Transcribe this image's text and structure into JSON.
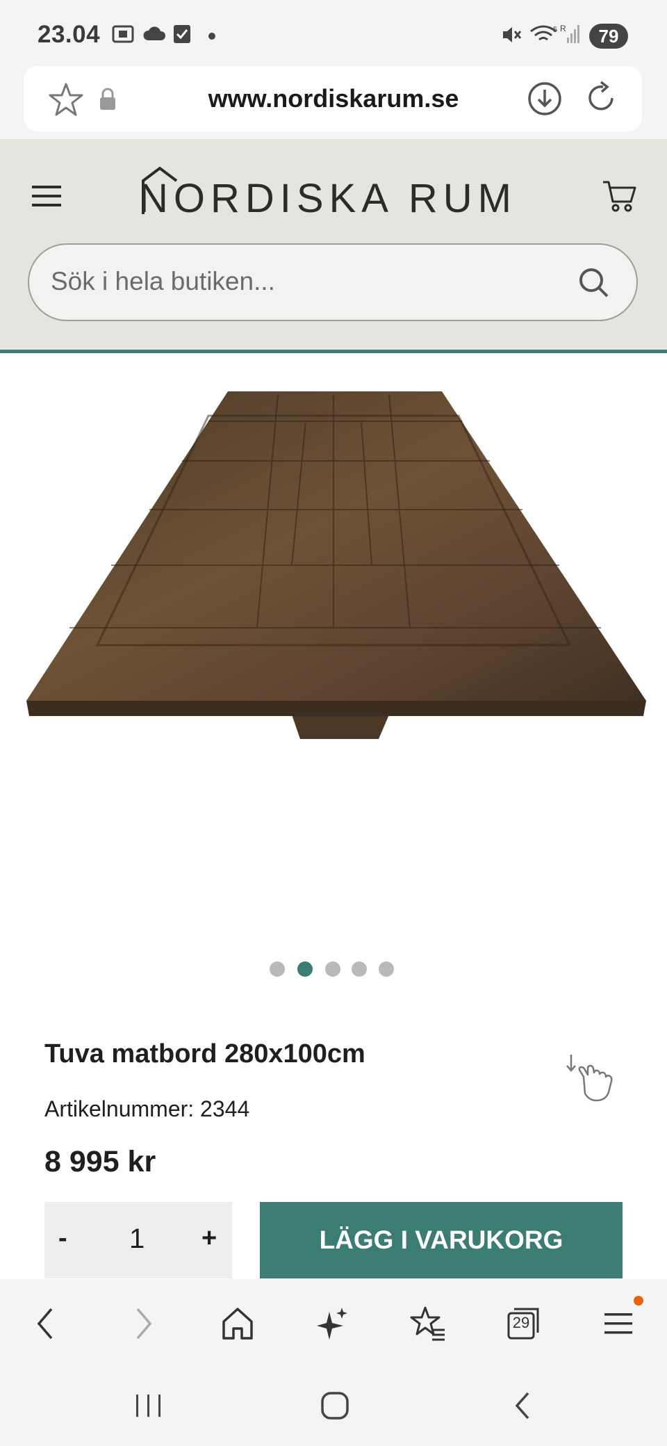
{
  "status_bar": {
    "time": "23.04",
    "battery": "79"
  },
  "browser": {
    "url": "www.nordiskarum.se",
    "tabs_count": "29"
  },
  "site": {
    "logo": "NORDISKA RUM",
    "search_placeholder": "Sök i hela butiken..."
  },
  "gallery": {
    "slide_count": 5,
    "active_index": 1
  },
  "product": {
    "title": "Tuva matbord 280x100cm",
    "sku_label": "Artikelnummer: 2344",
    "price": "8 995 kr",
    "quantity": "1",
    "minus_label": "-",
    "plus_label": "+",
    "add_to_cart_label": "LÄGG I VARUKORG"
  },
  "colors": {
    "accent": "#3b7c73",
    "header_bg": "#e5e4df",
    "notification": "#e8630a"
  }
}
